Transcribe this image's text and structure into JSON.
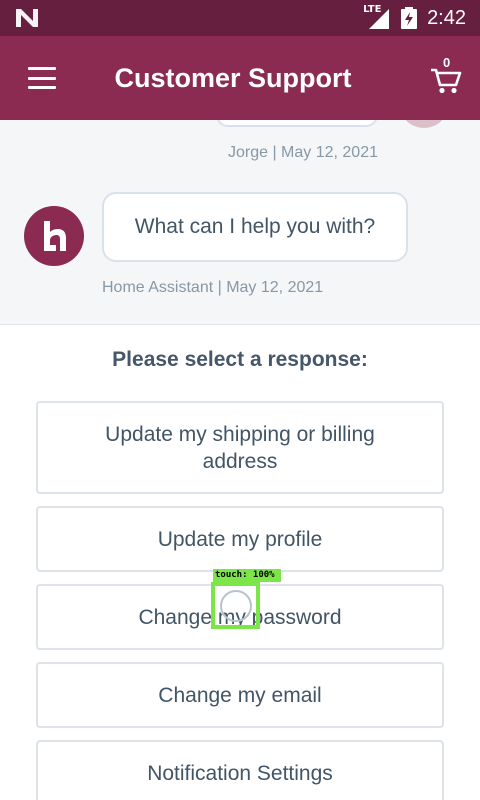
{
  "status_bar": {
    "time": "2:42",
    "network": "LTE",
    "os_logo_icon": "n-logo-icon",
    "battery_icon": "battery-charging-icon"
  },
  "header": {
    "title": "Customer Support",
    "menu_icon": "hamburger-menu-icon",
    "cart_icon": "shopping-cart-icon",
    "cart_count": "0"
  },
  "chat": {
    "user_message_meta": "Jorge | May 12, 2021",
    "bot_message": "What can I help you with?",
    "bot_message_meta": "Home Assistant | May 12, 2021",
    "bot_avatar_letter": "h"
  },
  "responses": {
    "title": "Please select a response:",
    "options": [
      "Update my shipping or billing address",
      "Update my profile",
      "Change my password",
      "Change my email",
      "Notification Settings"
    ]
  },
  "touch_overlay": {
    "label": "touch: 100%"
  },
  "colors": {
    "status_bar": "#661f3f",
    "app_bar": "#8b2b52",
    "chat_background": "#f4f6f8",
    "text": "#425566",
    "meta_text": "#8798a7",
    "touch_indicator": "#7be54a"
  }
}
